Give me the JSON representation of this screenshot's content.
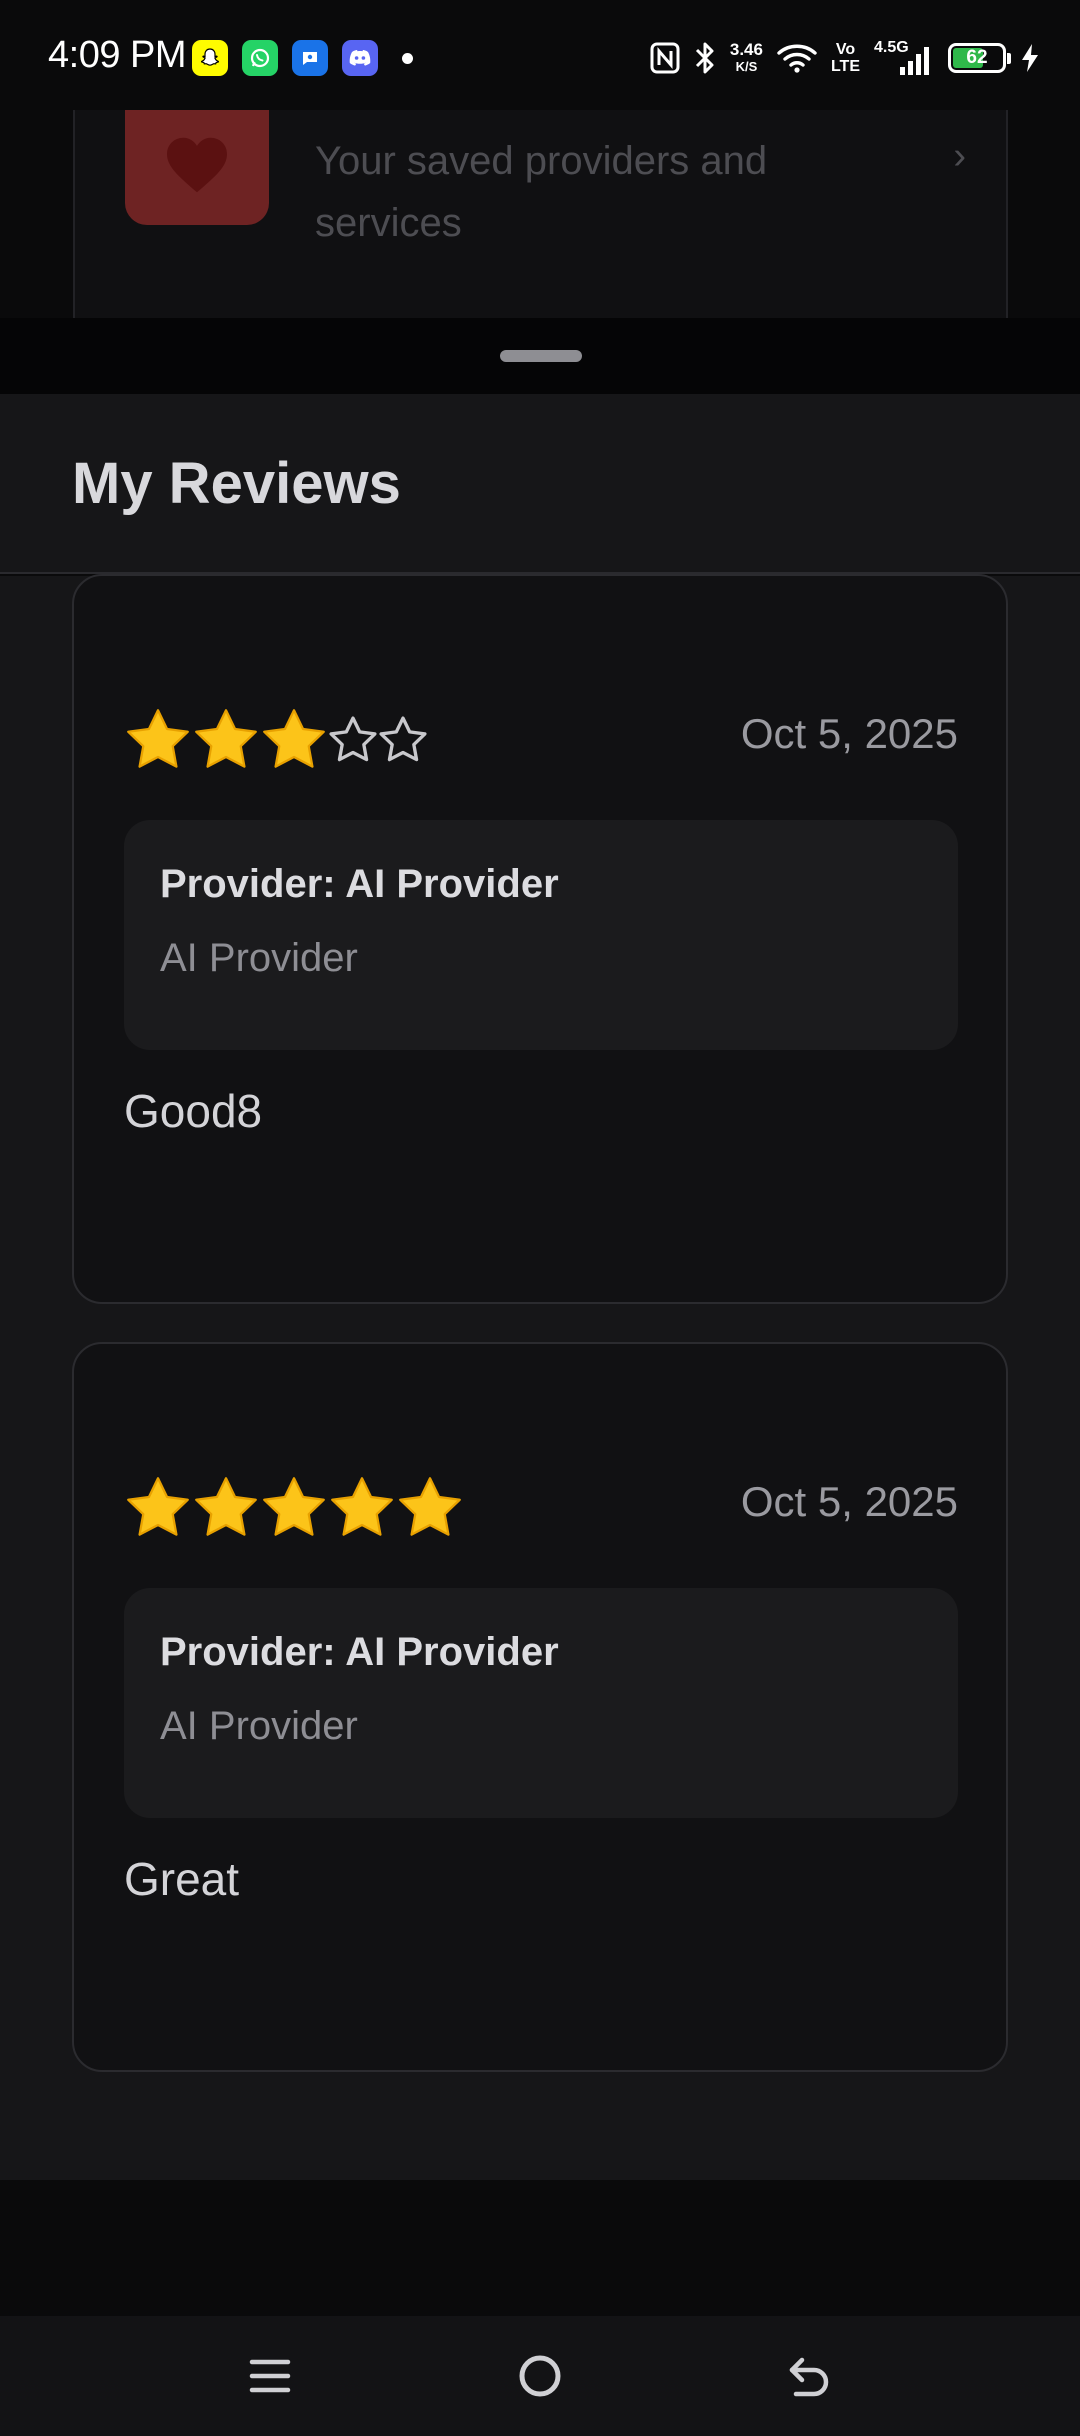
{
  "status_bar": {
    "time": "4:09 PM",
    "notification_icons": [
      "snapchat-icon",
      "whatsapp-icon",
      "messages-icon",
      "discord-icon"
    ],
    "net_speed_value": "3.46",
    "net_speed_unit": "K/S",
    "volte_top": "Vo",
    "volte_bottom": "LTE",
    "network_type": "4.5G",
    "battery_level": "62",
    "battery_fraction": 0.62,
    "battery_color": "#2fb84a"
  },
  "background": {
    "favorites_subtitle": "Your saved providers and services",
    "favorites_icon": "heart-icon",
    "chevron": "›"
  },
  "sheet": {
    "title": "My Reviews"
  },
  "reviews": [
    {
      "rating": 3,
      "max_rating": 5,
      "date": "Oct 5, 2025",
      "provider_label": "Provider: AI Provider",
      "provider_name": "AI Provider",
      "text": "Good8"
    },
    {
      "rating": 5,
      "max_rating": 5,
      "date": "Oct 5, 2025",
      "provider_label": "Provider: AI Provider",
      "provider_name": "AI Provider",
      "text": "Great"
    }
  ],
  "nav_bar": {
    "icons": [
      "menu-icon",
      "home-icon",
      "back-icon"
    ]
  }
}
